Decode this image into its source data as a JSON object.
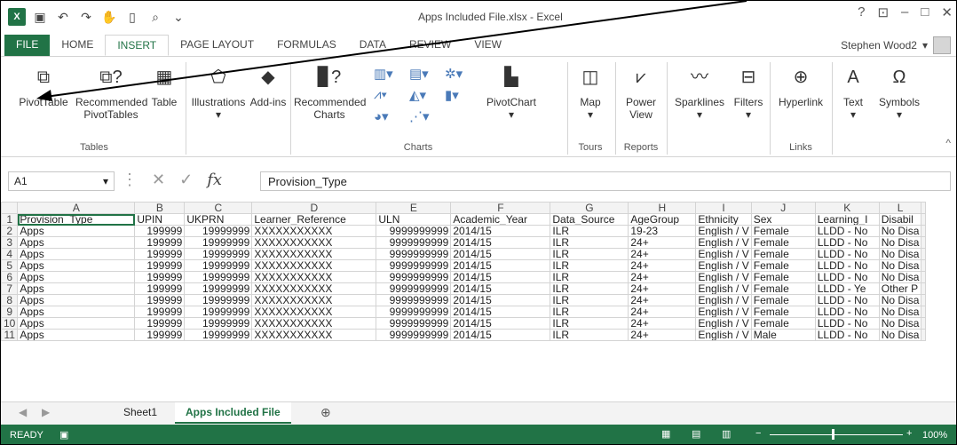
{
  "window": {
    "title": "Apps Included File.xlsx - Excel",
    "help": "?",
    "user": "Stephen Wood2"
  },
  "tabs": [
    "FILE",
    "HOME",
    "INSERT",
    "PAGE LAYOUT",
    "FORMULAS",
    "DATA",
    "REVIEW",
    "VIEW"
  ],
  "ribbon": {
    "pivot": "PivotTable",
    "recommended_pivot": "Recommended PivotTables",
    "table": "Table",
    "illustrations": "Illustrations",
    "addins": "Add-ins",
    "recommended_charts": "Recommended Charts",
    "pivotchart": "PivotChart",
    "map": "Map",
    "powerview": "Power View",
    "sparklines": "Sparklines",
    "filters": "Filters",
    "hyperlink": "Hyperlink",
    "text": "Text",
    "symbols": "Symbols",
    "groups": {
      "tables": "Tables",
      "charts": "Charts",
      "tours": "Tours",
      "reports": "Reports",
      "links": "Links"
    }
  },
  "formula_bar": {
    "cell": "A1",
    "formula": "Provision_Type",
    "fx": "fx"
  },
  "columns": [
    "A",
    "B",
    "C",
    "D",
    "E",
    "F",
    "G",
    "H",
    "I",
    "J",
    "K",
    "L"
  ],
  "rows": [
    [
      "Provision_Type",
      "UPIN",
      "UKPRN",
      "Learner_Reference",
      "ULN",
      "Academic_Year",
      "Data_Source",
      "AgeGroup",
      "Ethnicity",
      "Sex",
      "Learning_I",
      "Disabil"
    ],
    [
      "Apps",
      "199999",
      "19999999",
      "XXXXXXXXXXX",
      "9999999999",
      "2014/15",
      "ILR",
      "19-23",
      "English / V",
      "Female",
      "LLDD - No",
      "No Disa"
    ],
    [
      "Apps",
      "199999",
      "19999999",
      "XXXXXXXXXXX",
      "9999999999",
      "2014/15",
      "ILR",
      "24+",
      "English / V",
      "Female",
      "LLDD - No",
      "No Disa"
    ],
    [
      "Apps",
      "199999",
      "19999999",
      "XXXXXXXXXXX",
      "9999999999",
      "2014/15",
      "ILR",
      "24+",
      "English / V",
      "Female",
      "LLDD - No",
      "No Disa"
    ],
    [
      "Apps",
      "199999",
      "19999999",
      "XXXXXXXXXXX",
      "9999999999",
      "2014/15",
      "ILR",
      "24+",
      "English / V",
      "Female",
      "LLDD - No",
      "No Disa"
    ],
    [
      "Apps",
      "199999",
      "19999999",
      "XXXXXXXXXXX",
      "9999999999",
      "2014/15",
      "ILR",
      "24+",
      "English / V",
      "Female",
      "LLDD - No",
      "No Disa"
    ],
    [
      "Apps",
      "199999",
      "19999999",
      "XXXXXXXXXXX",
      "9999999999",
      "2014/15",
      "ILR",
      "24+",
      "English / V",
      "Female",
      "LLDD - Ye",
      "Other P"
    ],
    [
      "Apps",
      "199999",
      "19999999",
      "XXXXXXXXXXX",
      "9999999999",
      "2014/15",
      "ILR",
      "24+",
      "English / V",
      "Female",
      "LLDD - No",
      "No Disa"
    ],
    [
      "Apps",
      "199999",
      "19999999",
      "XXXXXXXXXXX",
      "9999999999",
      "2014/15",
      "ILR",
      "24+",
      "English / V",
      "Female",
      "LLDD - No",
      "No Disa"
    ],
    [
      "Apps",
      "199999",
      "19999999",
      "XXXXXXXXXXX",
      "9999999999",
      "2014/15",
      "ILR",
      "24+",
      "English / V",
      "Female",
      "LLDD - No",
      "No Disa"
    ],
    [
      "Apps",
      "199999",
      "19999999",
      "XXXXXXXXXXX",
      "9999999999",
      "2014/15",
      "ILR",
      "24+",
      "English / V",
      "Male",
      "LLDD - No",
      "No Disa"
    ]
  ],
  "sheets": [
    "Sheet1",
    "Apps Included File"
  ],
  "status": {
    "mode": "READY",
    "zoom": "100%"
  }
}
